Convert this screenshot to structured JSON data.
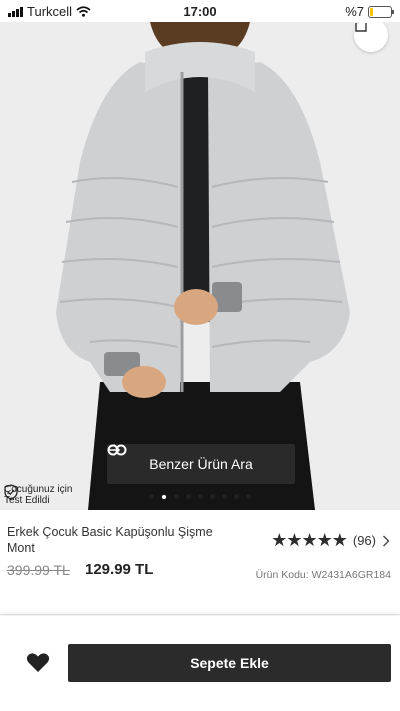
{
  "status": {
    "carrier": "Turkcell",
    "time": "17:00",
    "battery": "%7"
  },
  "hero": {
    "similar_label": "Benzer Ürün Ara",
    "tested_line1": "Çocuğunuz için",
    "tested_line2": "Test Edildi",
    "dots_count": 9,
    "active_dot": 1
  },
  "product": {
    "name": "Erkek Çocuk Basic Kapüşonlu Şişme Mont",
    "rating_count": "(96)",
    "rating_value": 4.5,
    "old_price": "399.99 TL",
    "new_price": "129.99 TL",
    "code": "Ürün Kodu: W2431A6GR184"
  },
  "actions": {
    "add_to_cart": "Sepete Ekle"
  }
}
